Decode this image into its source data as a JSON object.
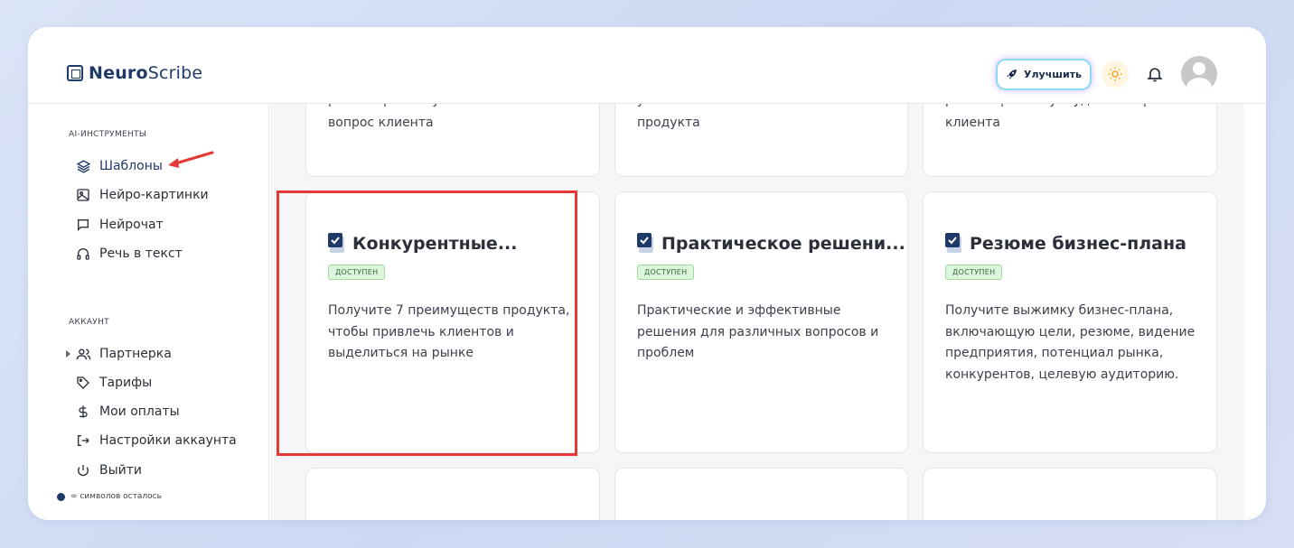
{
  "app": {
    "logo_bold": "Neuro",
    "logo_rest": "Scribe"
  },
  "header": {
    "upgrade_label": "Улучшить",
    "icons": [
      "rocket-icon",
      "sun-icon",
      "bell-icon",
      "avatar"
    ]
  },
  "sidebar": {
    "tools_title": "AI-ИНСТРУМЕНТЫ",
    "tools": [
      {
        "label": "Шаблоны",
        "icon": "layers-icon",
        "active": true
      },
      {
        "label": "Нейро-картинки",
        "icon": "image-icon"
      },
      {
        "label": "Нейрочат",
        "icon": "chat-icon"
      },
      {
        "label": "Речь в текст",
        "icon": "headphones-icon"
      }
    ],
    "account_title": "АККАУНТ",
    "account": [
      {
        "label": "Партнерка",
        "icon": "users-icon"
      },
      {
        "label": "Тарифы",
        "icon": "tag-icon"
      },
      {
        "label": "Мои оплаты",
        "icon": "dollar-icon"
      },
      {
        "label": "Настройки аккаунта",
        "icon": "logout-arrow-icon"
      },
      {
        "label": "Выйти",
        "icon": "power-icon"
      }
    ],
    "symbols_text": "∞ символов осталось"
  },
  "cards_top": [
    {
      "partial_1": "решит проблему или ответит на",
      "partial_2": "вопрос клиента"
    },
    {
      "partial_1": "уникальных возможностей вашего",
      "partial_2": "продукта"
    },
    {
      "partial_1": "решит проблему и удовлетворит",
      "partial_2": "клиента"
    }
  ],
  "cards": [
    {
      "title": "Конкурентные...",
      "badge": "ДОСТУПЕН",
      "description": "Получите 7 преимуществ продукта, чтобы привлечь клиентов и выделиться на рынке"
    },
    {
      "title": "Практическое решени...",
      "badge": "ДОСТУПЕН",
      "description": "Практические и эффективные решения для различных вопросов и проблем"
    },
    {
      "title": "Резюме бизнес-плана",
      "badge": "ДОСТУПЕН",
      "description": "Получите выжимку бизнес-плана, включающую цели, резюме, видение предприятия, потенциал рынка, конкурентов, целевую аудиторию."
    }
  ],
  "colors": {
    "brand": "#1f3a68",
    "highlight": "#e53935",
    "badge_bg": "#dcf5dc"
  }
}
